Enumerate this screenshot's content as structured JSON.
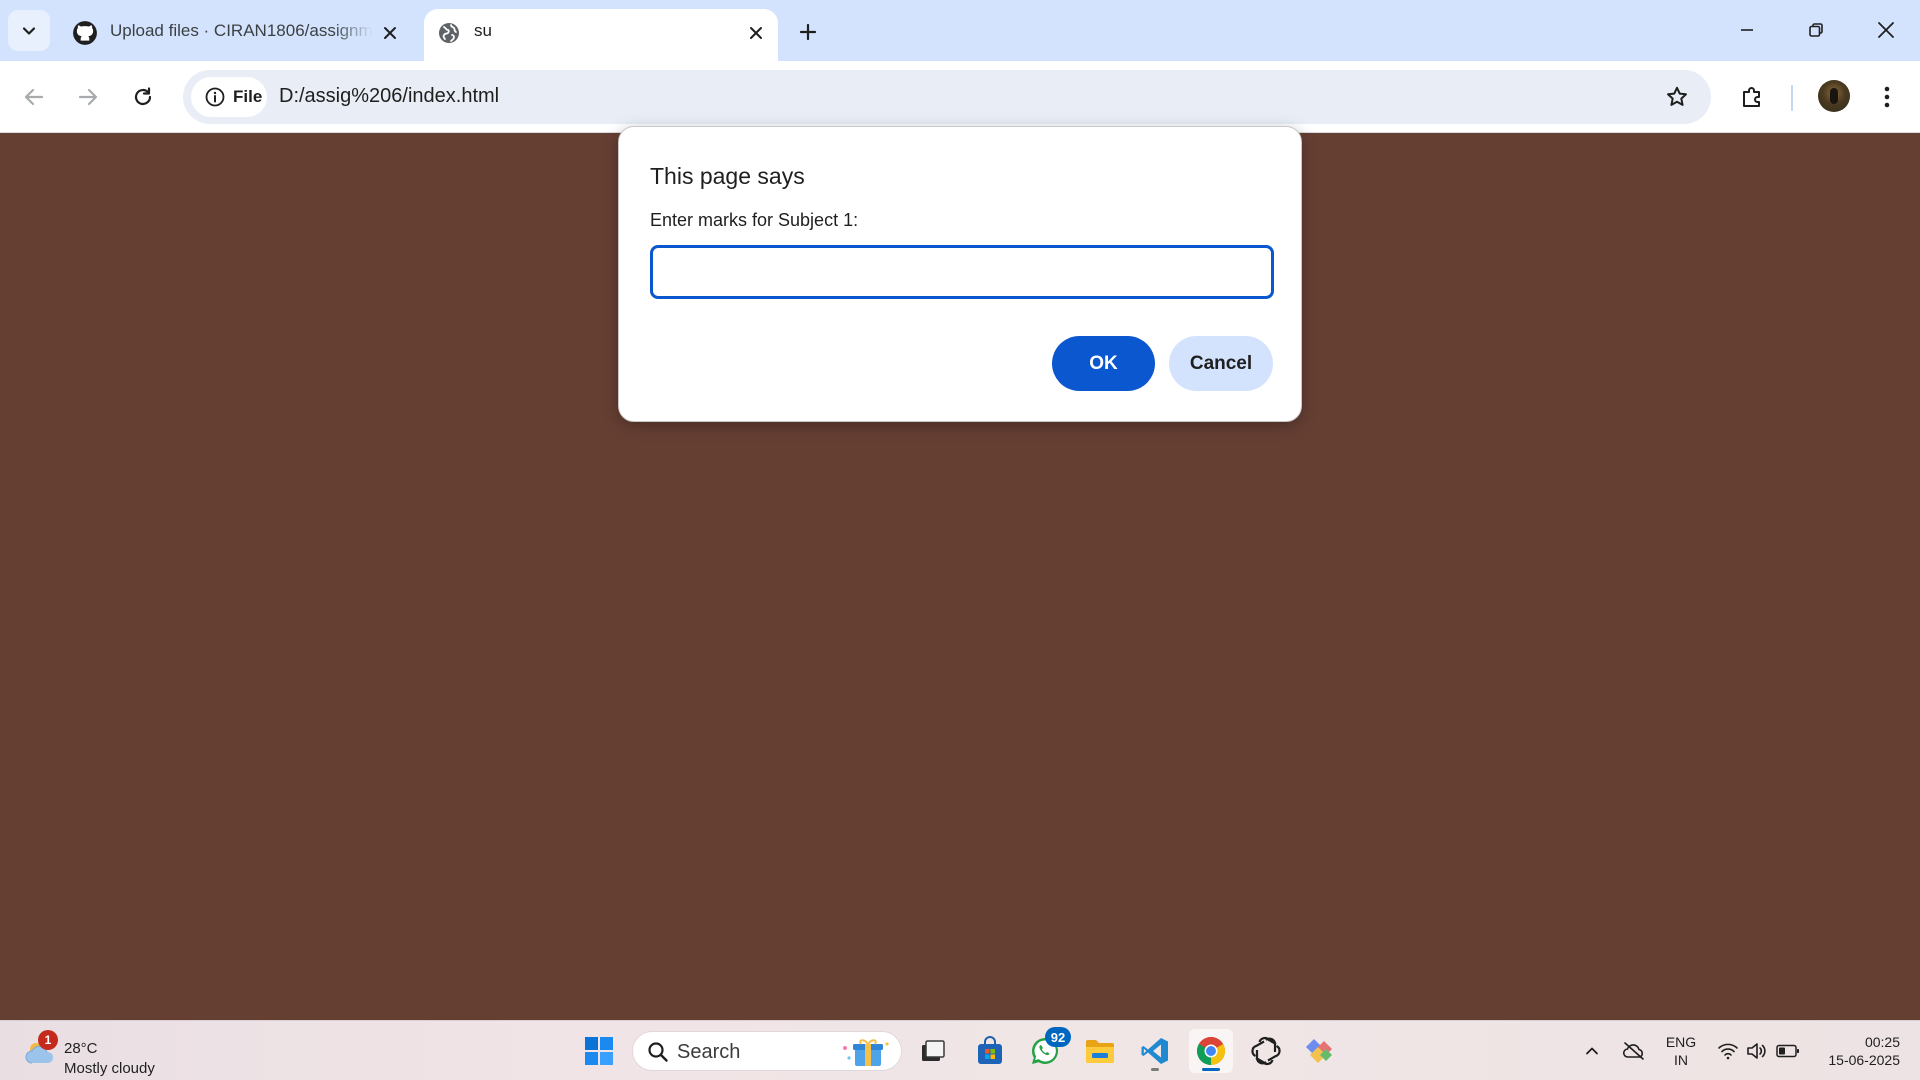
{
  "browser": {
    "tabs": [
      {
        "title": "Upload files · CIRAN1806/assignment",
        "favicon": "github-icon",
        "active": false
      },
      {
        "title": "su",
        "favicon": "globe-icon",
        "active": true
      }
    ],
    "address_bar": {
      "scheme_chip": "File",
      "url": "D:/assig%206/index.html"
    }
  },
  "dialog": {
    "title": "This page says",
    "message": "Enter marks for Subject 1:",
    "input_value": "",
    "ok_label": "OK",
    "cancel_label": "Cancel"
  },
  "taskbar": {
    "weather": {
      "temperature": "28°C",
      "condition": "Mostly cloudy",
      "badge": "1"
    },
    "search_label": "Search",
    "whatsapp_badge": "92",
    "language": {
      "line1": "ENG",
      "line2": "IN"
    },
    "clock": {
      "time": "00:25",
      "date": "15-06-2025"
    }
  },
  "colors": {
    "page_background": "#663f33",
    "accent": "#0b57d0",
    "tabstrip": "#d3e3fd"
  }
}
